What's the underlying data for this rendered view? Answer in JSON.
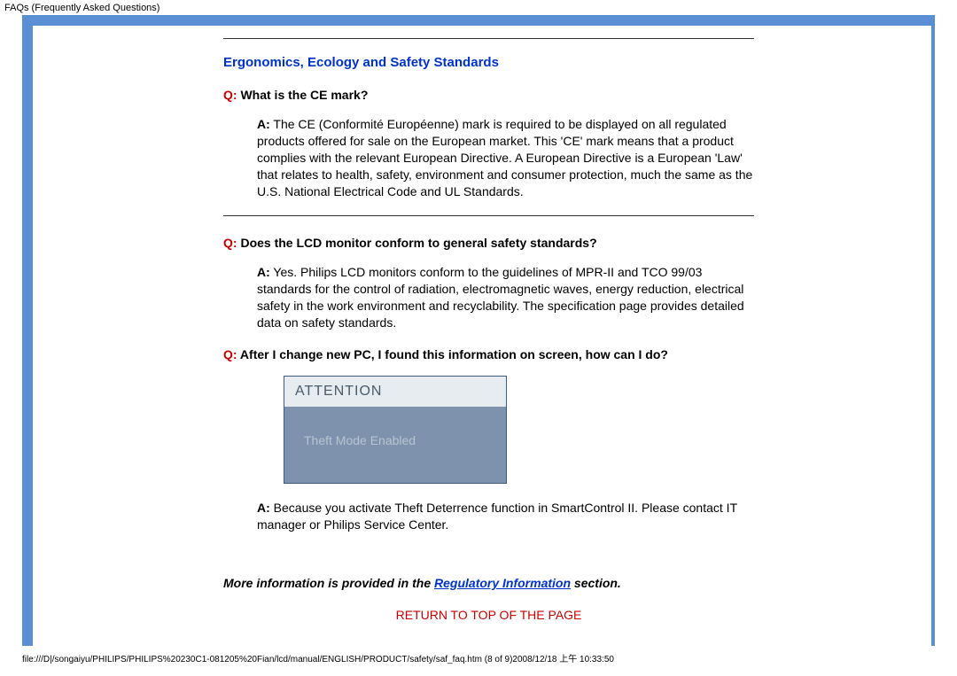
{
  "pageTitle": "FAQs (Frequently Asked Questions)",
  "sectionHeading": "Ergonomics, Ecology and Safety Standards",
  "qPrefix": "Q:",
  "aPrefix": "A:",
  "faq1": {
    "question": " What is the CE mark?",
    "answer": " The CE (Conformité Européenne) mark is required to be displayed on all regulated products offered for sale on the European market. This 'CE' mark means that a product complies with the relevant European Directive. A European Directive is a European 'Law' that relates to health, safety, environment and consumer protection, much the same as the U.S. National Electrical Code and UL Standards."
  },
  "faq2": {
    "question": " Does the LCD monitor conform to general safety standards?",
    "answer": " Yes. Philips LCD monitors conform to the guidelines of MPR-II and TCO 99/03 standards for the control of radiation, electromagnetic waves, energy reduction, electrical safety in the work environment and recyclability. The specification page provides detailed data on safety standards."
  },
  "faq3": {
    "question": " After I change new PC, I found this information on screen, how can I do?",
    "attentionTitle": "ATTENTION",
    "attentionBody": "Theft Mode Enabled",
    "answer": " Because you activate Theft Deterrence function in SmartControl II. Please contact IT manager or Philips Service Center."
  },
  "moreInfo": {
    "before": "More information is provided in the ",
    "link": "Regulatory Information",
    "after": " section."
  },
  "returnLink": "RETURN TO TOP OF THE PAGE",
  "footerPath": "file:///D|/songaiyu/PHILIPS/PHILIPS%20230C1-081205%20Fian/lcd/manual/ENGLISH/PRODUCT/safety/saf_faq.htm (8 of 9)2008/12/18 上午 10:33:50"
}
